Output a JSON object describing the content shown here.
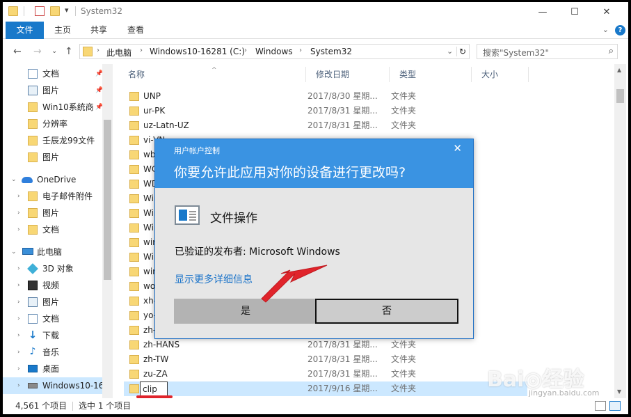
{
  "titlebar": {
    "title": "System32",
    "qa_caret": "▾",
    "minimize": "—",
    "maximize": "☐",
    "close": "✕"
  },
  "ribbon": {
    "tabs": [
      "文件",
      "主页",
      "共享",
      "查看"
    ],
    "expand": "⌄",
    "help": "?"
  },
  "nav": {
    "back": "←",
    "forward": "→",
    "recent": "⌄",
    "up": "↑",
    "breadcrumb": [
      "此电脑",
      "Windows10-16281 (C:)",
      "Windows",
      "System32"
    ],
    "crumb_sep": "›",
    "dropdown": "⌄",
    "refresh": "↻"
  },
  "search": {
    "placeholder": "搜索\"System32\"",
    "icon": "⌕"
  },
  "navpane": {
    "items": [
      {
        "label": "文档",
        "icon": "doc-icon",
        "pinned": true
      },
      {
        "label": "图片",
        "icon": "pictures-icon",
        "pinned": true
      },
      {
        "label": "Win10系统商",
        "icon": "folder-icon",
        "pinned": true
      },
      {
        "label": "分辨率",
        "icon": "folder-icon"
      },
      {
        "label": "壬辰龙99文件",
        "icon": "folder-icon"
      },
      {
        "label": "图片",
        "icon": "folder-icon"
      },
      {
        "label": "OneDrive",
        "icon": "onedrive-icon",
        "expanded": true
      },
      {
        "label": "电子邮件附件",
        "icon": "folder-icon"
      },
      {
        "label": "图片",
        "icon": "folder-icon"
      },
      {
        "label": "文档",
        "icon": "folder-icon"
      },
      {
        "label": "此电脑",
        "icon": "pc-icon",
        "expanded": true
      },
      {
        "label": "3D 对象",
        "icon": "3d-objects-icon"
      },
      {
        "label": "视频",
        "icon": "video-icon"
      },
      {
        "label": "图片",
        "icon": "pictures-icon"
      },
      {
        "label": "文档",
        "icon": "doc-icon"
      },
      {
        "label": "下载",
        "icon": "download-icon"
      },
      {
        "label": "音乐",
        "icon": "music-icon"
      },
      {
        "label": "桌面",
        "icon": "desktop-icon"
      },
      {
        "label": "Windows10-16",
        "icon": "drive-icon",
        "selected": true
      }
    ],
    "pin_glyph": "📌",
    "chev_collapsed": "›",
    "chev_expanded": "⌄"
  },
  "list": {
    "columns": [
      "名称",
      "修改日期",
      "类型",
      "大小"
    ],
    "sort_glyph": "^",
    "rows": [
      {
        "name": "UNP",
        "date": "2017/8/30 星期...",
        "type": "文件夹"
      },
      {
        "name": "ur-PK",
        "date": "2017/8/31 星期...",
        "type": "文件夹"
      },
      {
        "name": "uz-Latn-UZ",
        "date": "2017/8/31 星期...",
        "type": "文件夹"
      },
      {
        "name": "vi-VN",
        "date": "",
        "type": ""
      },
      {
        "name": "wbe",
        "date": "",
        "type": ""
      },
      {
        "name": "WC",
        "date": "",
        "type": ""
      },
      {
        "name": "WD",
        "date": "",
        "type": ""
      },
      {
        "name": "Win",
        "date": "",
        "type": ""
      },
      {
        "name": "Win",
        "date": "",
        "type": ""
      },
      {
        "name": "Win",
        "date": "",
        "type": ""
      },
      {
        "name": "win",
        "date": "",
        "type": ""
      },
      {
        "name": "Win",
        "date": "",
        "type": ""
      },
      {
        "name": "win",
        "date": "",
        "type": ""
      },
      {
        "name": "wo-",
        "date": "",
        "type": ""
      },
      {
        "name": "xh-",
        "date": "",
        "type": ""
      },
      {
        "name": "yo-",
        "date": "",
        "type": ""
      },
      {
        "name": "zh-",
        "date": "",
        "type": ""
      },
      {
        "name": "zh-HANS",
        "date": "2017/8/31 星期...",
        "type": "文件夹"
      },
      {
        "name": "zh-TW",
        "date": "2017/8/31 星期...",
        "type": "文件夹"
      },
      {
        "name": "zu-ZA",
        "date": "2017/8/31 星期...",
        "type": "文件夹"
      },
      {
        "name": "clip",
        "date": "2017/9/16 星期...",
        "type": "文件夹",
        "renaming": true
      }
    ],
    "scroll_up": "▲",
    "scroll_down": "▼"
  },
  "status": {
    "count": "4,561 个项目",
    "selected": "选中 1 个项目"
  },
  "uac": {
    "caption": "用户帐户控制",
    "close": "✕",
    "question": "你要允许此应用对你的设备进行更改吗?",
    "app_name": "文件操作",
    "publisher": "已验证的发布者: Microsoft Windows",
    "more_details": "显示更多详细信息",
    "yes": "是",
    "no": "否"
  },
  "watermark": {
    "brand": "Bai◎经验",
    "url": "jingyan.baidu.com"
  },
  "colors": {
    "accent": "#1979ca",
    "uac_header": "#3a93e2",
    "annotation_red": "#e0242b",
    "selection": "#cce8ff"
  }
}
